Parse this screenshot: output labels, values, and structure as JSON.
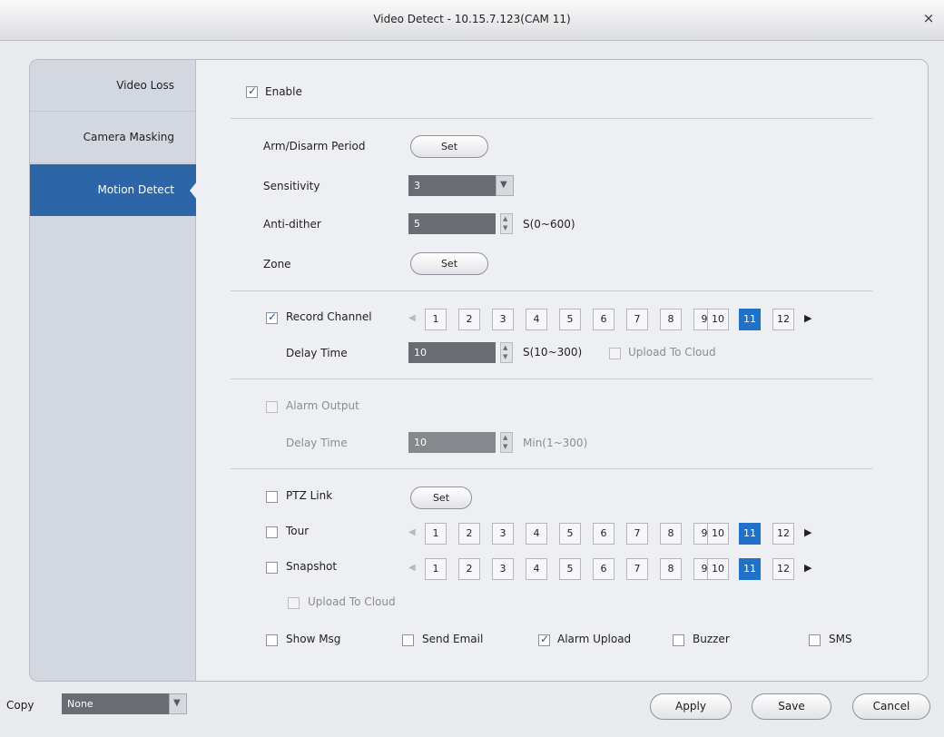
{
  "window": {
    "title": "Video Detect - 10.15.7.123(CAM 11)",
    "close_glyph": "×"
  },
  "sidebar": {
    "items": [
      {
        "label": "Video Loss",
        "active": false
      },
      {
        "label": "Camera Masking",
        "active": false
      },
      {
        "label": "Motion Detect",
        "active": true
      }
    ]
  },
  "enable": {
    "label": "Enable",
    "checked": true
  },
  "arm_disarm": {
    "label": "Arm/Disarm Period",
    "button": "Set"
  },
  "sensitivity": {
    "label": "Sensitivity",
    "value": "3"
  },
  "anti_dither": {
    "label": "Anti-dither",
    "value": "5",
    "range": "S(0~600)"
  },
  "zone": {
    "label": "Zone",
    "button": "Set"
  },
  "record_channel": {
    "label": "Record Channel",
    "checked": true
  },
  "record_delay": {
    "label": "Delay Time",
    "value": "10",
    "range": "S(10~300)",
    "upload_label": "Upload To Cloud",
    "upload_checked": false
  },
  "alarm_output": {
    "label": "Alarm Output",
    "checked": false
  },
  "alarm_delay": {
    "label": "Delay Time",
    "value": "10",
    "range": "Min(1~300)"
  },
  "ptz_link": {
    "label": "PTZ Link",
    "checked": false,
    "button": "Set"
  },
  "tour": {
    "label": "Tour",
    "checked": false
  },
  "snapshot": {
    "label": "Snapshot",
    "checked": false,
    "upload_label": "Upload To Cloud",
    "upload_checked": false
  },
  "channels": [
    "1",
    "2",
    "3",
    "4",
    "5",
    "6",
    "7",
    "8",
    "9",
    "10",
    "11",
    "12"
  ],
  "selected_channel": "11",
  "bottom_checks": [
    {
      "label": "Show Msg",
      "checked": false
    },
    {
      "label": "Send Email",
      "checked": false
    },
    {
      "label": "Alarm Upload",
      "checked": true
    },
    {
      "label": "Buzzer",
      "checked": false
    },
    {
      "label": "SMS",
      "checked": false
    }
  ],
  "footer": {
    "copy_label": "Copy",
    "copy_value": "None",
    "apply": "Apply",
    "save": "Save",
    "cancel": "Cancel"
  },
  "colors": {
    "accent": "#2c65a8",
    "selected_channel": "#1f72c7",
    "field": "#6a6c73"
  }
}
